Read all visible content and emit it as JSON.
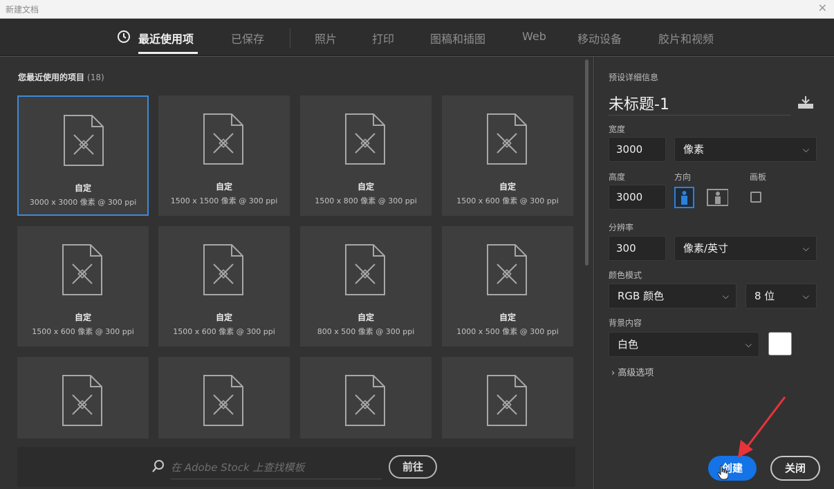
{
  "window": {
    "title": "新建文档",
    "close_glyph": "✕"
  },
  "tabs": [
    {
      "label": "最近使用项",
      "active": true,
      "icon": "clock-icon"
    },
    {
      "label": "已保存"
    },
    {
      "label": "照片"
    },
    {
      "label": "打印"
    },
    {
      "label": "图稿和插图"
    },
    {
      "label": "Web"
    },
    {
      "label": "移动设备"
    },
    {
      "label": "胶片和视频"
    }
  ],
  "recent": {
    "title": "您最近使用的项目",
    "count": "(18)",
    "items": [
      {
        "name": "自定",
        "size": "3000 x 3000 像素 @ 300 ppi",
        "selected": true
      },
      {
        "name": "自定",
        "size": "1500 x 1500 像素 @ 300 ppi"
      },
      {
        "name": "自定",
        "size": "1500 x 800 像素 @ 300 ppi"
      },
      {
        "name": "自定",
        "size": "1500 x 600 像素 @ 300 ppi"
      },
      {
        "name": "自定",
        "size": "1500 x 600 像素 @ 300 ppi"
      },
      {
        "name": "自定",
        "size": "1500 x 600 像素 @ 300 ppi"
      },
      {
        "name": "自定",
        "size": "800 x 500 像素 @ 300 ppi"
      },
      {
        "name": "自定",
        "size": "1000 x 500 像素 @ 300 ppi"
      },
      {
        "name": "",
        "size": ""
      },
      {
        "name": "",
        "size": ""
      },
      {
        "name": "",
        "size": ""
      },
      {
        "name": "",
        "size": ""
      }
    ]
  },
  "stock": {
    "placeholder": "在 Adobe Stock 上查找模板",
    "go_label": "前往"
  },
  "preset": {
    "heading": "预设详细信息",
    "doc_title": "未标题-1",
    "width_label": "宽度",
    "width_value": "3000",
    "width_unit": "像素",
    "height_label": "高度",
    "height_value": "3000",
    "orientation_label": "方向",
    "artboard_label": "画板",
    "resolution_label": "分辨率",
    "resolution_value": "300",
    "resolution_unit": "像素/英寸",
    "color_mode_label": "颜色模式",
    "color_mode_value": "RGB 颜色",
    "bit_depth_value": "8 位",
    "background_label": "背景内容",
    "background_value": "白色",
    "background_color": "#ffffff",
    "advanced_label": "高级选项",
    "create_label": "创建",
    "close_label": "关闭"
  },
  "colors": {
    "accent": "#1473e6",
    "selection": "#3c8bd8",
    "annotation": "#e8333a"
  }
}
